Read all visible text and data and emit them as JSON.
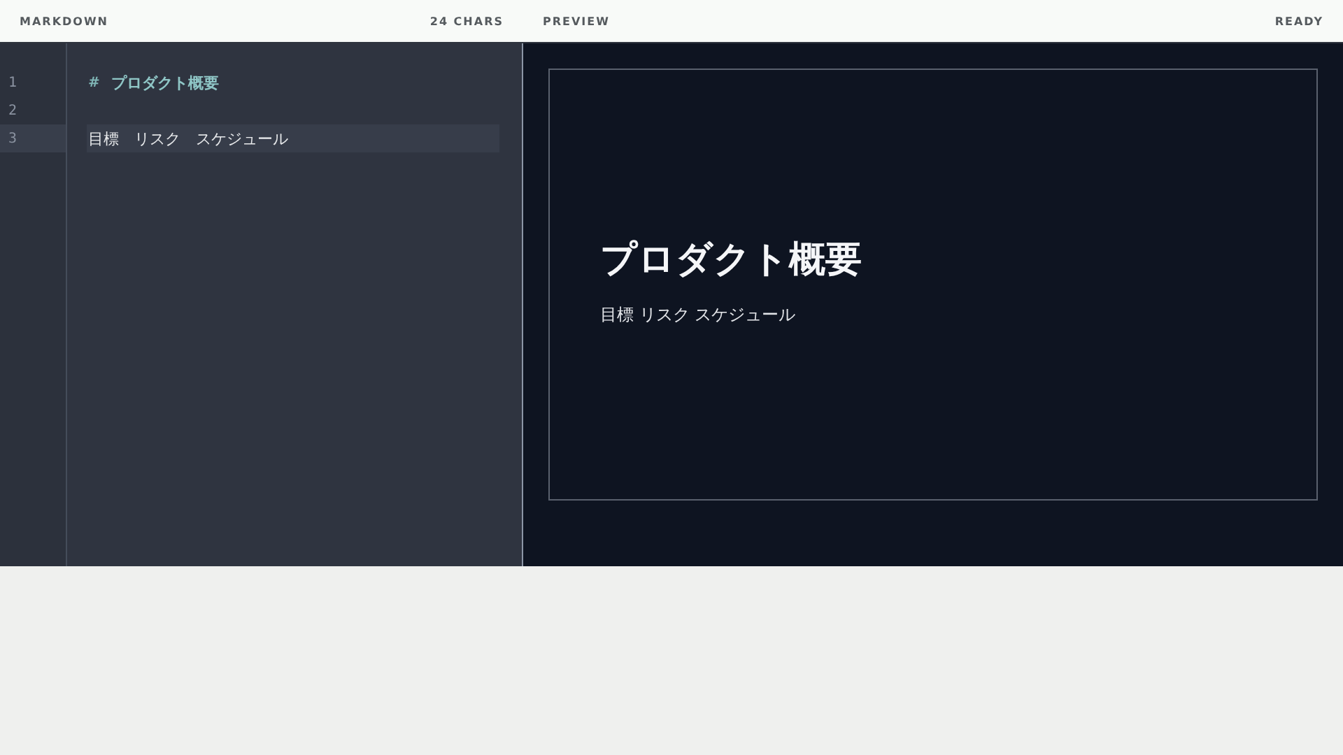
{
  "editor": {
    "title": "MARKDOWN",
    "count": "24 CHARS",
    "lines": [
      {
        "number": "1",
        "kind": "heading",
        "marker": "#",
        "text": "プロダクト概要",
        "selected": false
      },
      {
        "number": "2",
        "kind": "blank",
        "selected": false
      },
      {
        "number": "3",
        "kind": "text",
        "text": "目標　リスク　スケジュール",
        "selected": true
      }
    ]
  },
  "preview": {
    "title": "PREVIEW",
    "status": "READY",
    "heading": "プロダクト概要",
    "body": "目標 リスク スケジュール"
  }
}
